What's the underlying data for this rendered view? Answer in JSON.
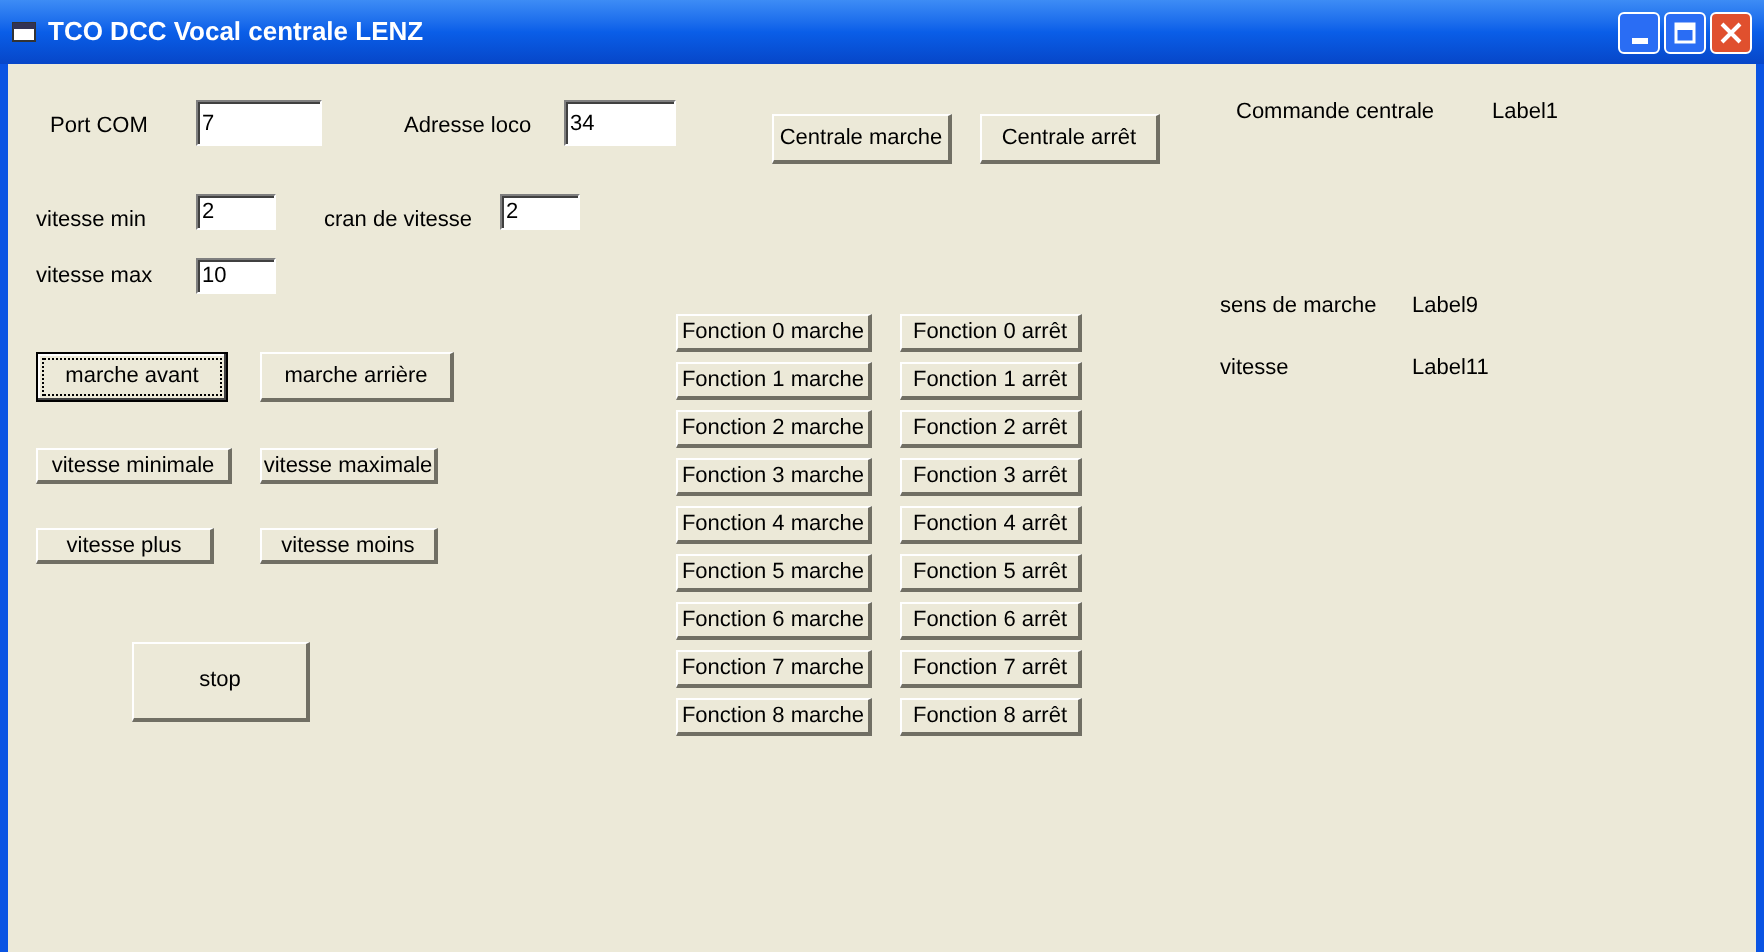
{
  "window": {
    "title": "TCO DCC Vocal centrale LENZ"
  },
  "fields": [
    {
      "label": "Port COM",
      "value": "7"
    },
    {
      "label": "Adresse loco",
      "value": "34"
    },
    {
      "label": "vitesse min",
      "value": "2"
    },
    {
      "label": "cran de vitesse",
      "value": "2"
    },
    {
      "label": "vitesse max",
      "value": "10"
    }
  ],
  "buttons": [
    {
      "label": "Centrale marche",
      "focused": false
    },
    {
      "label": "Centrale arrêt",
      "focused": false
    },
    {
      "label": "marche avant",
      "focused": true
    },
    {
      "label": "marche arrière",
      "focused": false
    },
    {
      "label": "vitesse minimale",
      "focused": false
    },
    {
      "label": "vitesse maximale",
      "focused": false
    },
    {
      "label": "vitesse plus",
      "focused": false
    },
    {
      "label": "vitesse moins",
      "focused": false
    },
    {
      "label": "stop",
      "focused": false
    }
  ],
  "function_buttons": [
    {
      "on": "Fonction 0 marche",
      "off": "Fonction 0 arrêt"
    },
    {
      "on": "Fonction 1 marche",
      "off": "Fonction 1 arrêt"
    },
    {
      "on": "Fonction 2 marche",
      "off": "Fonction 2 arrêt"
    },
    {
      "on": "Fonction 3 marche",
      "off": "Fonction 3 arrêt"
    },
    {
      "on": "Fonction 4 marche",
      "off": "Fonction 4 arrêt"
    },
    {
      "on": "Fonction 5 marche",
      "off": "Fonction 5 arrêt"
    },
    {
      "on": "Fonction 6 marche",
      "off": "Fonction 6 arrêt"
    },
    {
      "on": "Fonction 7 marche",
      "off": "Fonction 7 arrêt"
    },
    {
      "on": "Fonction 8 marche",
      "off": "Fonction 8 arrêt"
    }
  ],
  "status": [
    {
      "label": "Commande centrale",
      "value": "Label1"
    },
    {
      "label": "sens de marche",
      "value": "Label9"
    },
    {
      "label": "vitesse",
      "value": "Label11"
    }
  ]
}
